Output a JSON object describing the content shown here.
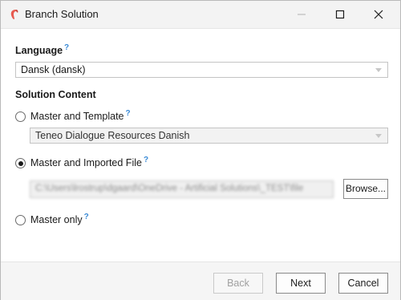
{
  "window": {
    "title": "Branch Solution",
    "icon": "teneo-app-icon",
    "controls": [
      "minimize",
      "maximize",
      "close"
    ]
  },
  "language": {
    "label": "Language",
    "help": "?",
    "selected": "Dansk (dansk)"
  },
  "solution_content": {
    "label": "Solution Content",
    "options": [
      {
        "label": "Master and Template",
        "help": "?",
        "checked": false
      },
      {
        "label": "Master and Imported File",
        "help": "?",
        "checked": true
      },
      {
        "label": "Master only",
        "help": "?",
        "checked": false
      }
    ],
    "template_select": "Teneo Dialogue Resources Danish",
    "file_path": "C:\\Users\\lrostrup\\dgaard\\OneDrive - Artificial Solutions\\_TEST\\file",
    "browse_label": "Browse..."
  },
  "footer": {
    "back_label": "Back",
    "next_label": "Next",
    "cancel_label": "Cancel"
  },
  "colors": {
    "help_accent": "#3a8ad6",
    "app_icon": "#e85a4f"
  }
}
